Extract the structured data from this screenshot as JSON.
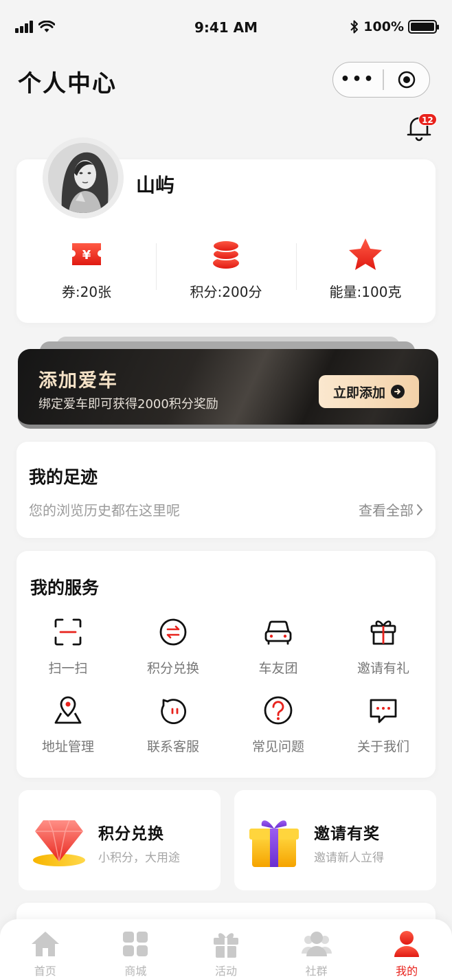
{
  "status_bar": {
    "time": "9:41 AM",
    "battery": "100%"
  },
  "nav": {
    "title": "个人中心",
    "more_label": "•••"
  },
  "notifications": {
    "badge_count": "12"
  },
  "profile": {
    "username": "山屿",
    "stats": [
      {
        "label": "券:20张",
        "icon": "coupon-icon"
      },
      {
        "label": "积分:200分",
        "icon": "coins-icon"
      },
      {
        "label": "能量:100克",
        "icon": "star-icon"
      }
    ]
  },
  "car_banner": {
    "title": "添加爱车",
    "subtitle": "绑定爱车即可获得2000积分奖励",
    "button": "立即添加"
  },
  "footprint": {
    "title": "我的足迹",
    "subtitle": "您的浏览历史都在这里呢",
    "view_all": "查看全部"
  },
  "services": {
    "title": "我的服务",
    "items": [
      {
        "label": "扫一扫",
        "icon": "scan-icon"
      },
      {
        "label": "积分兑换",
        "icon": "exchange-icon"
      },
      {
        "label": "车友团",
        "icon": "car-icon"
      },
      {
        "label": "邀请有礼",
        "icon": "gift-icon"
      },
      {
        "label": "地址管理",
        "icon": "location-icon"
      },
      {
        "label": "联系客服",
        "icon": "chat-bubble-icon"
      },
      {
        "label": "常见问题",
        "icon": "question-icon"
      },
      {
        "label": "关于我们",
        "icon": "message-icon"
      }
    ]
  },
  "promos": [
    {
      "title": "积分兑换",
      "subtitle": "小积分，大用途",
      "icon": "ruby-icon"
    },
    {
      "title": "邀请有奖",
      "subtitle": "邀请新人立得",
      "icon": "gift-box-icon"
    }
  ],
  "tabbar": {
    "items": [
      {
        "label": "首页",
        "icon": "home-icon"
      },
      {
        "label": "商城",
        "icon": "grid-icon"
      },
      {
        "label": "活动",
        "icon": "gift-icon"
      },
      {
        "label": "社群",
        "icon": "users-icon"
      },
      {
        "label": "我的",
        "icon": "user-icon",
        "active": true
      }
    ]
  },
  "colors": {
    "accent": "#e8221c",
    "banner_gold": "#f4e1c6",
    "muted": "#9b9b9b"
  }
}
